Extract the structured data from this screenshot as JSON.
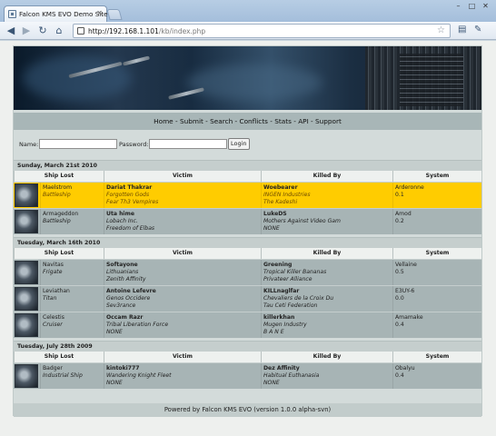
{
  "browser": {
    "tab_title": "Falcon KMS EVO Demo Site",
    "url_host": "http://192.168.1.101",
    "url_path": "/kb/index.php"
  },
  "nav": {
    "items": [
      "Home",
      "Submit",
      "Search",
      "Conflicts",
      "Stats",
      "API",
      "Support"
    ],
    "separator": " - "
  },
  "login": {
    "name_label": "Name:",
    "password_label": "Password:",
    "button": "Login"
  },
  "table_headers": {
    "ship_lost": "Ship Lost",
    "victim": "Victim",
    "killed_by": "Killed By",
    "system": "System"
  },
  "days": [
    {
      "date": "Sunday, March 21st 2010",
      "kills": [
        {
          "ship": "Maelstrom",
          "class": "Battleship",
          "victim": "Dariat Thakrar",
          "victim_corp": "Forgotten Gods",
          "victim_alliance": "Fear Th3 Vempires",
          "killer": "Woebearer",
          "killer_corp": "INGEN Industries",
          "killer_alliance": "The Kadeshi",
          "system": "Arderonne",
          "security": "0.1",
          "highlight": true
        },
        {
          "ship": "Armageddon",
          "class": "Battleship",
          "victim": "Uta hime",
          "victim_corp": "Lobach Inc.",
          "victim_alliance": "Freedom of Elbas",
          "killer": "LukeDS",
          "killer_corp": "Mothers Against Video Gam",
          "killer_alliance": "NONE",
          "system": "Amod",
          "security": "0.2",
          "highlight": false
        }
      ]
    },
    {
      "date": "Tuesday, March 16th 2010",
      "kills": [
        {
          "ship": "Navitas",
          "class": "Frigate",
          "victim": "Softayone",
          "victim_corp": "Lithuanians",
          "victim_alliance": "Zenith Affinity",
          "killer": "Greening",
          "killer_corp": "Tropical Killer Bananas",
          "killer_alliance": "Privateer Alliance",
          "system": "Vellaine",
          "security": "0.5",
          "highlight": false
        },
        {
          "ship": "Leviathan",
          "class": "Titan",
          "victim": "Antoine Lefevre",
          "victim_corp": "Genos Occidere",
          "victim_alliance": "Sev3rance",
          "killer": "KILLnaglfar",
          "killer_corp": "Chevaliers de la Croix Du",
          "killer_alliance": "Tau Ceti Federation",
          "system": "E3UY-6",
          "security": "0.0",
          "highlight": false
        },
        {
          "ship": "Celestis",
          "class": "Cruiser",
          "victim": "Occam Razr",
          "victim_corp": "Tribal Liberation Force",
          "victim_alliance": "NONE",
          "killer": "killerkhan",
          "killer_corp": "Mugen Industry",
          "killer_alliance": "B A N E",
          "system": "Amamake",
          "security": "0.4",
          "highlight": false
        }
      ]
    },
    {
      "date": "Tuesday, July 28th 2009",
      "kills": [
        {
          "ship": "Badger",
          "class": "Industrial Ship",
          "victim": "kintoki777",
          "victim_corp": "Wandering Knight Fleet",
          "victim_alliance": "NONE",
          "killer": "Dez Affinity",
          "killer_corp": "Habitual Euthanasia",
          "killer_alliance": "NONE",
          "system": "Obalyu",
          "security": "0.4",
          "highlight": false
        }
      ]
    }
  ],
  "footer": "Powered by Falcon KMS EVO (version 1.0.0 alpha-svn)",
  "colors": {
    "highlight_row": "#ffcc00",
    "row": "#a7b4b5",
    "menu_bar": "#a8b6b7"
  }
}
